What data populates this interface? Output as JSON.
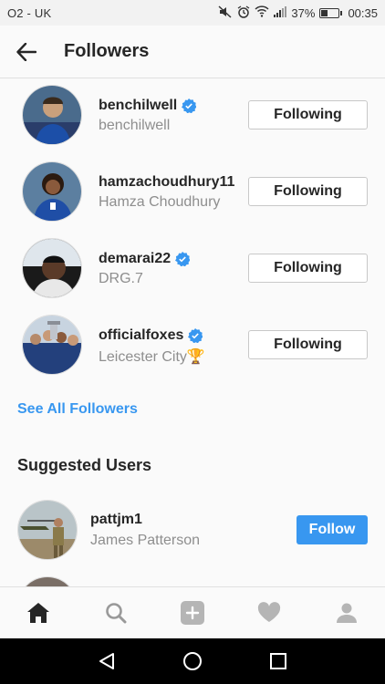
{
  "status_bar": {
    "carrier": "O2 - UK",
    "battery_percent": "37%",
    "battery_level": 0.37,
    "time": "00:35"
  },
  "header": {
    "title": "Followers"
  },
  "followers": [
    {
      "username": "benchilwell",
      "full_name": "benchilwell",
      "verified": true,
      "button": "Following"
    },
    {
      "username": "hamzachoudhury11",
      "full_name": "Hamza Choudhury",
      "verified": false,
      "button": "Following"
    },
    {
      "username": "demarai22",
      "full_name": "DRG.7",
      "verified": true,
      "button": "Following"
    },
    {
      "username": "officialfoxes",
      "full_name": "Leicester City🏆",
      "verified": true,
      "button": "Following"
    }
  ],
  "see_all_label": "See All Followers",
  "suggested": {
    "title": "Suggested Users",
    "users": [
      {
        "username": "pattjm1",
        "full_name": "James Patterson",
        "button": "Follow"
      }
    ]
  },
  "colors": {
    "accent": "#3897f0",
    "text": "#262626",
    "secondary_text": "#8e8e8e",
    "verified": "#3897f0"
  }
}
